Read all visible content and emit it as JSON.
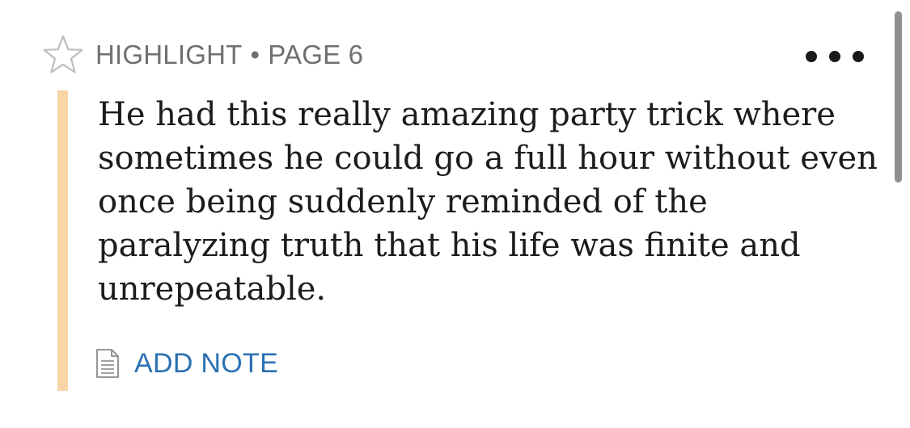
{
  "header": {
    "type_label": "HIGHLIGHT",
    "separator": "•",
    "page_label": "PAGE 6",
    "star_icon": "star-outline-icon",
    "more_icon": "more-horizontal-icon"
  },
  "highlight": {
    "text": "He had this really amazing party trick where sometimes he could go a full hour without even once being suddenly reminded of the paralyzing truth that his life was finite and unrepeatable.",
    "color": "#f8d4a6"
  },
  "note": {
    "label": "ADD NOTE",
    "icon": "note-icon",
    "color": "#2b71b3"
  }
}
